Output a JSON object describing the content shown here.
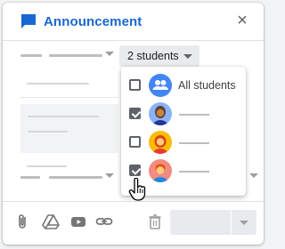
{
  "dialog": {
    "title": "Announcement",
    "close_icon": "close-icon",
    "header_icon": "announcement-icon",
    "accent_color": "#1967d2"
  },
  "audience": {
    "students_label": "2 students"
  },
  "student_menu": {
    "items": [
      {
        "label": "All students",
        "checked": false,
        "avatar": "group-icon"
      },
      {
        "label": "",
        "checked": true,
        "avatar": "student-avatar"
      },
      {
        "label": "",
        "checked": false,
        "avatar": "student-avatar"
      },
      {
        "label": "",
        "checked": true,
        "avatar": "student-avatar"
      }
    ]
  },
  "footer": {
    "icons": [
      "attach-icon",
      "drive-icon",
      "youtube-icon",
      "link-icon",
      "delete-icon"
    ]
  }
}
